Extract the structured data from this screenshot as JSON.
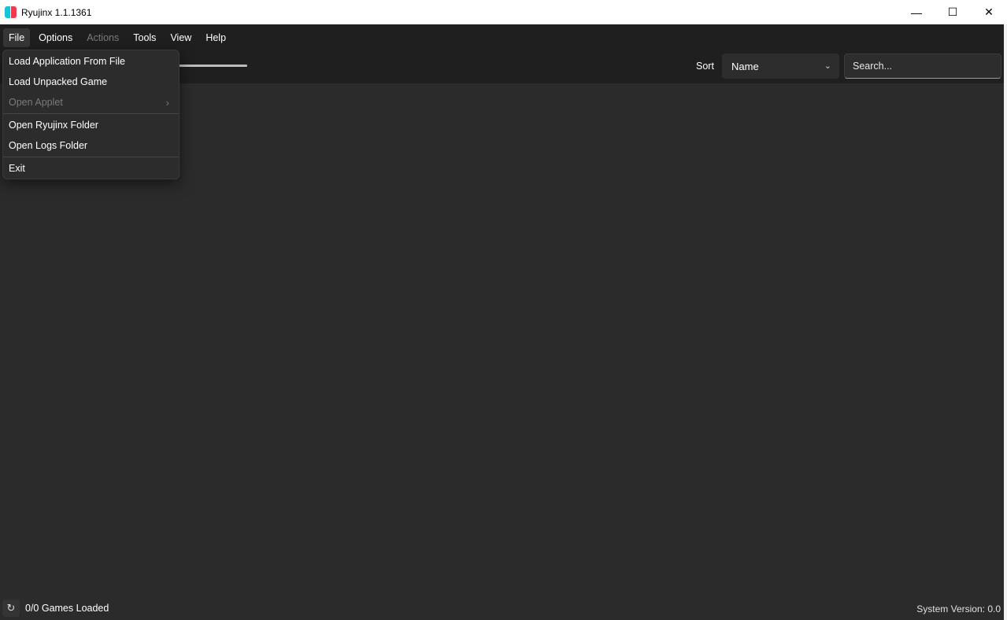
{
  "window": {
    "title": "Ryujinx 1.1.1361",
    "controls": {
      "minimize": "—",
      "maximize": "☐",
      "close": "✕"
    }
  },
  "menubar": {
    "items": [
      {
        "label": "File",
        "active": true,
        "disabled": false
      },
      {
        "label": "Options",
        "active": false,
        "disabled": false
      },
      {
        "label": "Actions",
        "active": false,
        "disabled": true
      },
      {
        "label": "Tools",
        "active": false,
        "disabled": false
      },
      {
        "label": "View",
        "active": false,
        "disabled": false
      },
      {
        "label": "Help",
        "active": false,
        "disabled": false
      }
    ]
  },
  "file_menu": {
    "items": [
      {
        "label": "Load Application From File",
        "disabled": false
      },
      {
        "label": "Load Unpacked Game",
        "disabled": false
      },
      {
        "label": "Open Applet",
        "disabled": true,
        "submenu": true
      },
      {
        "label": "Open Ryujinx Folder",
        "disabled": false
      },
      {
        "label": "Open Logs Folder",
        "disabled": false
      },
      {
        "label": "Exit",
        "disabled": false
      }
    ]
  },
  "toolbar": {
    "sort_label": "Sort",
    "sort_value": "Name",
    "search_placeholder": "Search..."
  },
  "statusbar": {
    "games_loaded": "0/0 Games Loaded",
    "system_version": "System Version: 0.0"
  },
  "icons": {
    "refresh": "refresh-icon",
    "chevron_down": "chevron-down-icon",
    "chevron_right": "chevron-right-icon"
  },
  "colors": {
    "background": "#2b2b2b",
    "bars": "#1f1f1f",
    "menu": "#2c2c2c",
    "disabled_text": "#7a7a7a"
  }
}
